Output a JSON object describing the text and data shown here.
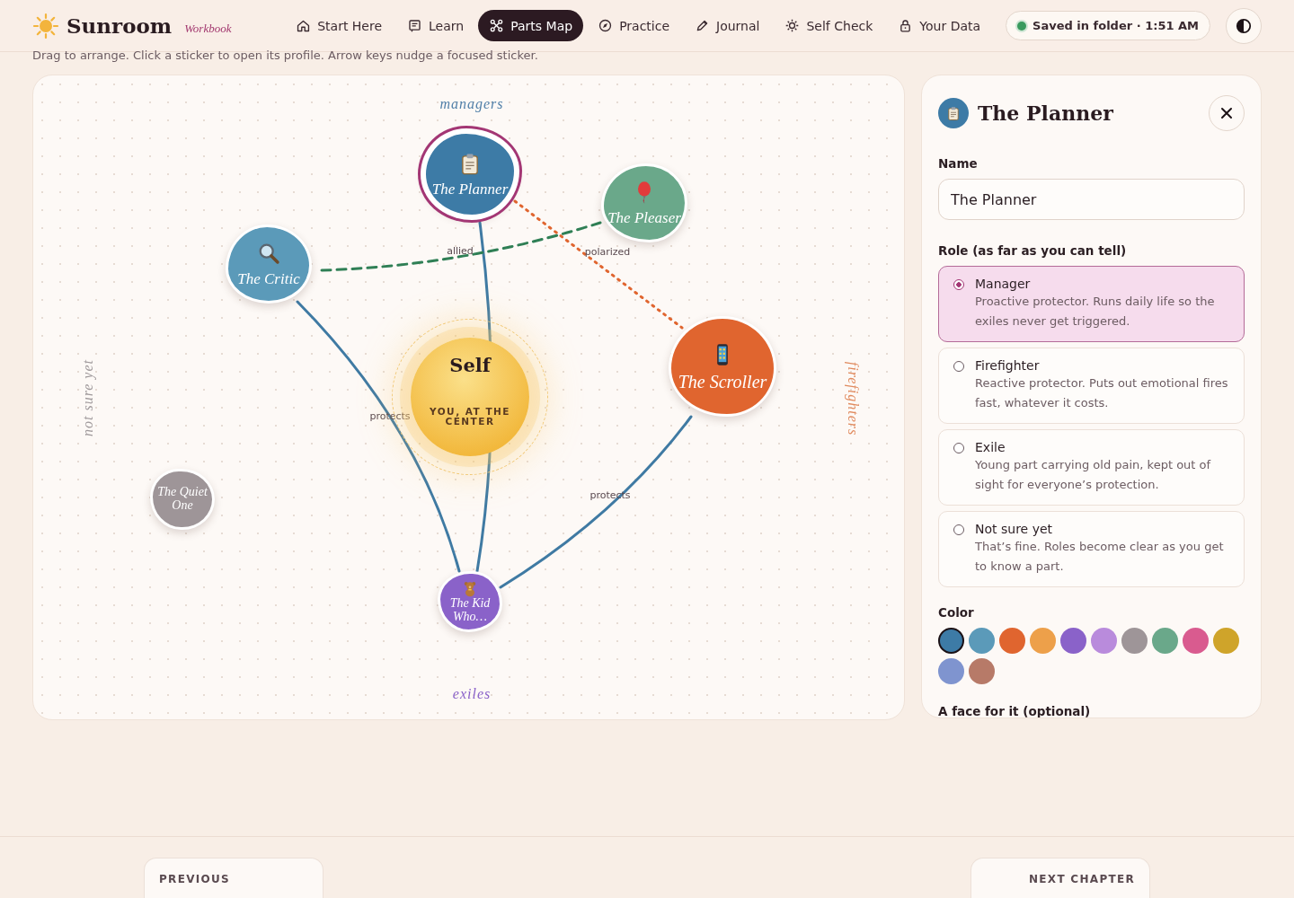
{
  "header": {
    "brand": "Sunroom",
    "subtitle": "Workbook",
    "save_status": "Saved in folder · 1:51 AM",
    "nav": [
      {
        "label": "Start Here",
        "selected": false
      },
      {
        "label": "Learn",
        "selected": false
      },
      {
        "label": "Parts Map",
        "selected": true
      },
      {
        "label": "Practice",
        "selected": false
      },
      {
        "label": "Journal",
        "selected": false
      },
      {
        "label": "Self Check",
        "selected": false
      },
      {
        "label": "Your Data",
        "selected": false
      }
    ]
  },
  "hint": "Drag to arrange. Click a sticker to open its profile. Arrow keys nudge a focused sticker.",
  "map": {
    "zones": [
      {
        "kind": "top",
        "label": "managers"
      },
      {
        "kind": "left",
        "label": "not sure yet"
      },
      {
        "kind": "right",
        "label": "firefighters"
      },
      {
        "kind": "bottom",
        "label": "exiles"
      }
    ],
    "self": {
      "title": "Self",
      "subtitle": "YOU, AT THE CENTER"
    },
    "parts": [
      {
        "name": "The Planner",
        "color": "#3d7ba6",
        "selected": true
      },
      {
        "name": "The Pleaser",
        "color": "#6aa88a",
        "selected": false
      },
      {
        "name": "The Critic",
        "color": "#5b9ab9",
        "selected": false
      },
      {
        "name": "The Scroller",
        "color": "#e0652f",
        "selected": false
      },
      {
        "name": "The Quiet One",
        "color": "#9e9598",
        "selected": false
      },
      {
        "name": "The Kid Who…",
        "color": "#8a62c9",
        "selected": false
      }
    ],
    "links": [
      {
        "kind": "protects"
      },
      {
        "kind": "protects",
        "label": "protects"
      },
      {
        "kind": "protects",
        "label": "protects"
      },
      {
        "kind": "allied",
        "label": "allied"
      },
      {
        "kind": "polarized",
        "label": "polarized"
      }
    ]
  },
  "panel": {
    "title": "The Planner",
    "name_label": "Name",
    "name_value": "The Planner",
    "role_label": "Role (as far as you can tell)",
    "roles": [
      {
        "title": "Manager",
        "description": "Proactive protector. Runs daily life so the exiles never get triggered.",
        "selected": true
      },
      {
        "title": "Firefighter",
        "description": "Reactive protector. Puts out emotional fires fast, whatever it costs.",
        "selected": false
      },
      {
        "title": "Exile",
        "description": "Young part carrying old pain, kept out of sight for everyone’s protection.",
        "selected": false
      },
      {
        "title": "Not sure yet",
        "description": "That’s fine. Roles become clear as you get to know a part.",
        "selected": false
      }
    ],
    "color_label": "Color",
    "colors": [
      {
        "color": "#3d7ba6",
        "selected": true
      },
      {
        "color": "#5b9ab9",
        "selected": false
      },
      {
        "color": "#e0652f",
        "selected": false
      },
      {
        "color": "#eda04a",
        "selected": false
      },
      {
        "color": "#8a62c9",
        "selected": false
      },
      {
        "color": "#b98bdc",
        "selected": false
      },
      {
        "color": "#9e9598",
        "selected": false
      },
      {
        "color": "#6aa88a",
        "selected": false
      },
      {
        "color": "#d95b8f",
        "selected": false
      },
      {
        "color": "#cfa42a",
        "selected": false
      },
      {
        "color": "#7f94cf",
        "selected": false
      },
      {
        "color": "#b77a68",
        "selected": false
      }
    ],
    "face_label": "A face for it (optional)"
  },
  "footer": {
    "previous_label": "PREVIOUS",
    "next_label": "NEXT CHAPTER"
  }
}
